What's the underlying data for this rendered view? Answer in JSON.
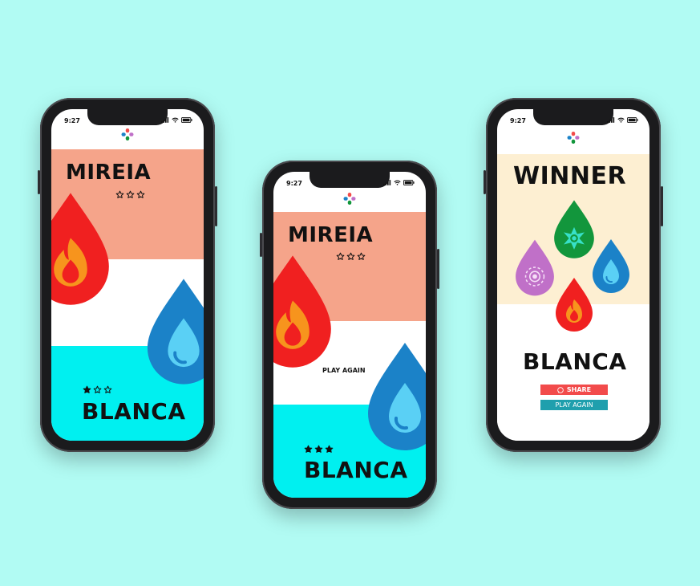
{
  "colors": {
    "background": "#b1fbf3",
    "salmon": "#f5a48a",
    "cyan": "#00f0f0",
    "cream": "#fdefd2",
    "fire_red": "#f02020",
    "fire_orange": "#f7941d",
    "water_blue": "#1b82c8",
    "leaf_green": "#12963c",
    "purple": "#c070c8",
    "share_red": "#f24b4b",
    "play_teal": "#1f9fad"
  },
  "phones": [
    {
      "status_time": "9:27",
      "top_player": {
        "name": "MIREIA",
        "stars": [
          0,
          0,
          0
        ]
      },
      "bottom_player": {
        "name": "BLANCA",
        "stars": [
          1,
          0,
          0
        ]
      },
      "icons": [
        "fire-drop-icon",
        "water-drop-icon"
      ]
    },
    {
      "status_time": "9:27",
      "top_player": {
        "name": "MIREIA",
        "stars": [
          0,
          0,
          0
        ]
      },
      "center_text": "PLAY AGAIN",
      "bottom_player": {
        "name": "BLANCA",
        "stars": [
          1,
          1,
          1
        ]
      },
      "icons": [
        "fire-drop-icon",
        "water-drop-icon"
      ]
    },
    {
      "status_time": "9:27",
      "title": "WINNER",
      "winner_name": "BLANCA",
      "share_label": "SHARE",
      "play_again_label": "PLAY AGAIN",
      "icons": [
        "leaf-drop-icon",
        "flower-drop-icon",
        "water-drop-icon",
        "fire-drop-icon"
      ]
    }
  ]
}
